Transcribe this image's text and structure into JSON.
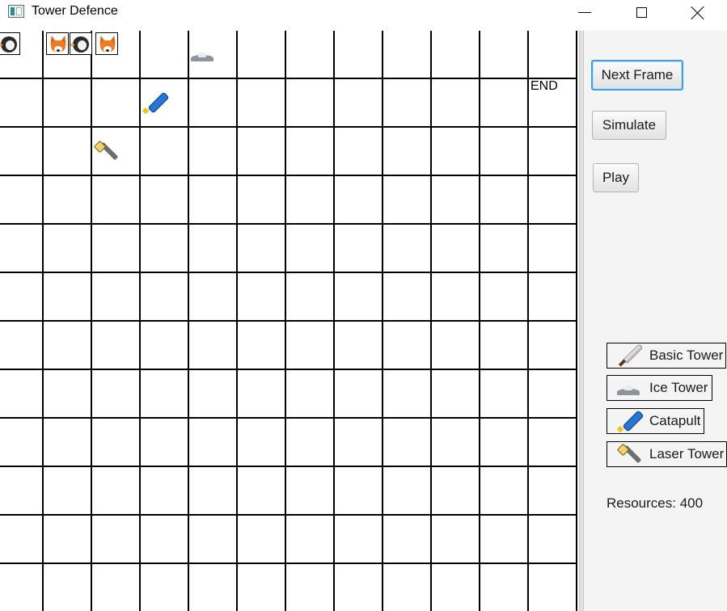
{
  "window": {
    "title": "Tower Defence",
    "icon": "app-window-icon",
    "controls": [
      "minimize-icon",
      "maximize-icon",
      "close-icon"
    ]
  },
  "grid": {
    "rows": 12,
    "cols": 12,
    "end_label": "END",
    "enemies": [
      {
        "type": "penguin",
        "col": 0
      },
      {
        "type": "fox",
        "col": 1
      },
      {
        "type": "penguin",
        "col": 1
      },
      {
        "type": "fox",
        "col": 2
      }
    ],
    "placed_towers": [
      {
        "type": "ice",
        "row": 0,
        "col": 4
      },
      {
        "type": "catapult",
        "row": 1,
        "col": 3
      },
      {
        "type": "laser",
        "row": 2,
        "col": 2
      }
    ]
  },
  "controls": {
    "next_frame": "Next Frame",
    "simulate": "Simulate",
    "play": "Play"
  },
  "tower_shop": [
    {
      "label": "Basic Tower",
      "icon": "sword-icon"
    },
    {
      "label": "Ice Tower",
      "icon": "snow-mound-icon"
    },
    {
      "label": "Catapult",
      "icon": "catapult-icon"
    },
    {
      "label": "Laser Tower",
      "icon": "flashlight-icon"
    }
  ],
  "status": {
    "resources": "Resources: 400"
  },
  "colors": {
    "accent_focus": "#3ea0e0",
    "panel_bg": "#f4f4f4",
    "grid_line": "#000000"
  }
}
